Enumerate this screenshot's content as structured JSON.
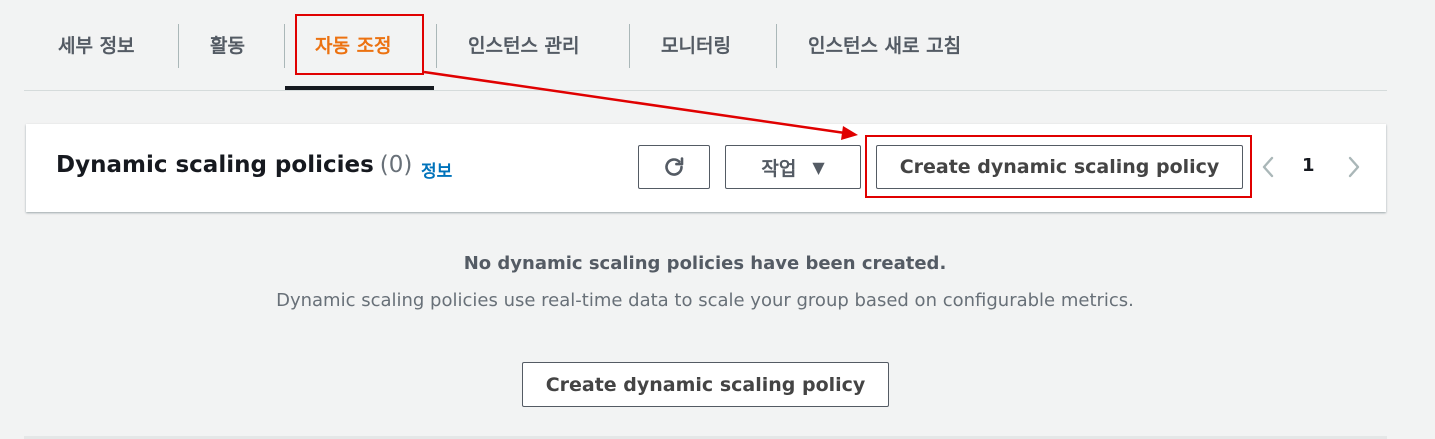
{
  "tabs": [
    {
      "label": "세부 정보",
      "active": false
    },
    {
      "label": "활동",
      "active": false
    },
    {
      "label": "자동 조정",
      "active": true
    },
    {
      "label": "인스턴스 관리",
      "active": false
    },
    {
      "label": "모니터링",
      "active": false
    },
    {
      "label": "인스턴스 새로 고침",
      "active": false
    }
  ],
  "panel": {
    "title": "Dynamic scaling policies",
    "count": "(0)",
    "info_link": "정보",
    "refresh_icon": "refresh-icon",
    "actions_label": "작업",
    "actions_caret_icon": "caret-down-icon",
    "create_label": "Create dynamic scaling policy",
    "pagination": {
      "prev_icon": "chevron-left-icon",
      "page": "1",
      "next_icon": "chevron-right-icon"
    }
  },
  "empty_state": {
    "title": "No dynamic scaling policies have been created.",
    "description": "Dynamic scaling policies use real-time data to scale your group based on configurable metrics.",
    "create_label": "Create dynamic scaling policy"
  },
  "colors": {
    "active_tab": "#ec7211",
    "link": "#0073bb",
    "annotation": "#e00000",
    "background": "#f2f3f3"
  }
}
